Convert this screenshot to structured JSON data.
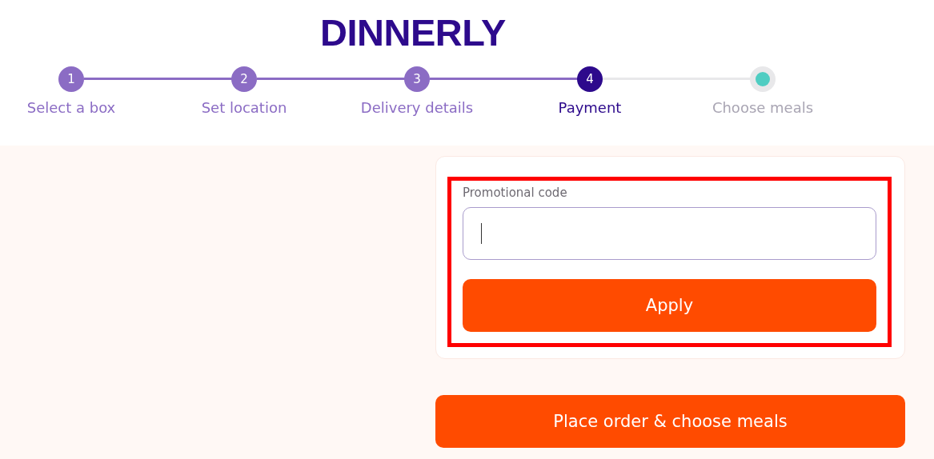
{
  "logo": "DINNERLY",
  "steps": [
    {
      "number": "1",
      "label": "Select a box",
      "completed": true,
      "selected": false
    },
    {
      "number": "2",
      "label": "Set location",
      "completed": true,
      "selected": false
    },
    {
      "number": "3",
      "label": "Delivery details",
      "completed": true,
      "selected": false
    },
    {
      "number": "4",
      "label": "Payment",
      "completed": false,
      "selected": true
    },
    {
      "label": "Choose meals",
      "completed": false,
      "selected": false
    }
  ],
  "promo": {
    "label": "Promotional code",
    "highlighted": true,
    "button": "Apply"
  },
  "submit_button": "Place order & choose meals"
}
